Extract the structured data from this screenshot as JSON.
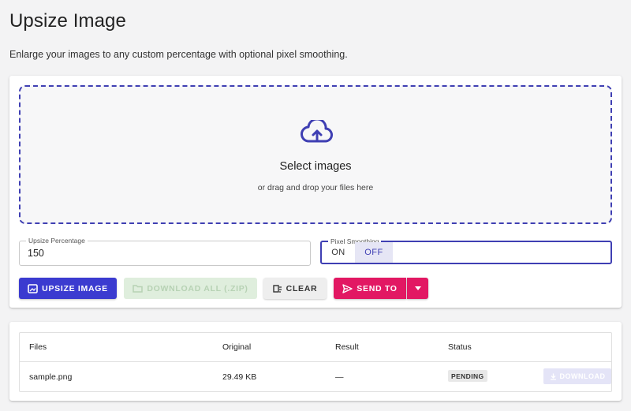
{
  "page": {
    "title": "Upsize Image",
    "subtitle": "Enlarge your images to any custom percentage with optional pixel smoothing."
  },
  "dropzone": {
    "icon": "cloud-upload-icon",
    "title": "Select images",
    "subtitle": "or drag and drop your files here"
  },
  "upsize_field": {
    "label": "Upsize Percentage",
    "value": "150"
  },
  "smoothing_field": {
    "label": "Pixel Smoothing",
    "on_label": "ON",
    "off_label": "OFF",
    "selected": "OFF"
  },
  "toolbar": {
    "upsize_label": "UPSIZE IMAGE",
    "download_all_label": "DOWNLOAD ALL (.ZIP)",
    "clear_label": "CLEAR",
    "send_to_label": "SEND TO"
  },
  "table": {
    "headers": [
      "Files",
      "Original",
      "Result",
      "Status"
    ],
    "rows": [
      {
        "file": "sample.png",
        "original": "29.49 KB",
        "result": "—",
        "status": "PENDING",
        "action_label": "DOWNLOAD"
      }
    ]
  },
  "colors": {
    "primary": "#3b3bd0",
    "accent": "#e21863",
    "disabled_green": "#dfeedd",
    "dropzone_border": "#3f3fb3"
  }
}
